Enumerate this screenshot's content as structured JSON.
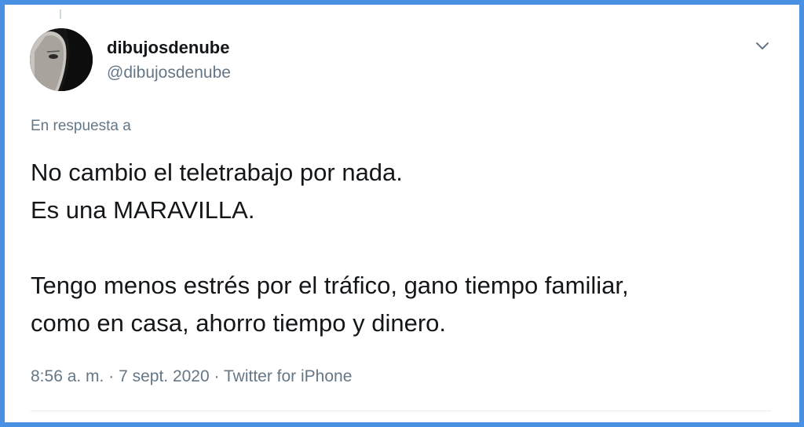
{
  "tweet": {
    "display_name": "dibujosdenube",
    "handle": "@dibujosdenube",
    "reply_to_label": "En respuesta a",
    "text_lines": [
      "No cambio el teletrabajo por nada.",
      "Es una MARAVILLA.",
      "",
      "Tengo menos estrés por el tráfico, gano tiempo familiar,",
      "como en casa, ahorro tiempo y dinero."
    ],
    "time": "8:56 a. m.",
    "separator": "·",
    "date": "7 sept. 2020",
    "source": "Twitter for iPhone"
  },
  "icons": {
    "menu": "chevron-down-icon",
    "avatar": "avatar"
  },
  "colors": {
    "frame_border": "#4a90e2",
    "primary_text": "#14171a",
    "secondary_text": "#657786",
    "divider": "#e6ecf0"
  }
}
